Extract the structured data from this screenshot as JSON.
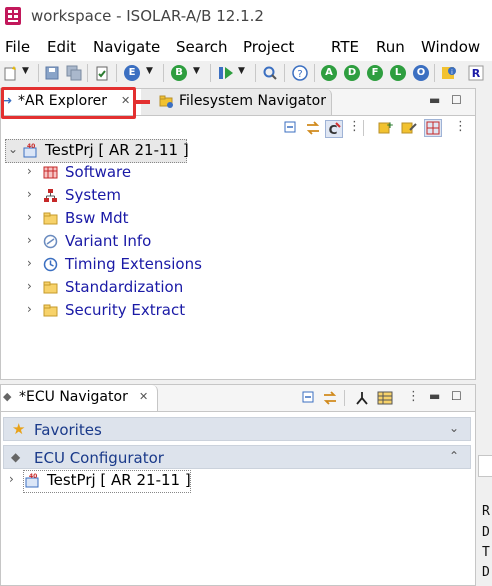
{
  "window": {
    "title": "workspace - ISOLAR-A/B 12.1.2"
  },
  "menu": [
    "File",
    "Edit",
    "Navigate",
    "Search",
    "Project",
    "RTE",
    "Run",
    "Window"
  ],
  "toolbar": {
    "circle_buttons": [
      {
        "letter": "E",
        "color": "#3b6fc1"
      },
      {
        "letter": "B",
        "color": "#2e9e3f"
      },
      {
        "letter": "A",
        "color": "#2e9e3f"
      },
      {
        "letter": "D",
        "color": "#2e9e3f"
      },
      {
        "letter": "F",
        "color": "#2e9e3f"
      },
      {
        "letter": "L",
        "color": "#2e9e3f"
      },
      {
        "letter": "O",
        "color": "#3b6fc1"
      }
    ]
  },
  "top_panel": {
    "tabs": [
      {
        "label": "*AR Explorer",
        "active": true
      },
      {
        "label": "Filesystem Navigator",
        "active": false
      }
    ],
    "tree": {
      "project": "TestPrj [ AR 21-11 ]",
      "children": [
        {
          "label": "Software",
          "icon": "software-icon"
        },
        {
          "label": "System",
          "icon": "system-icon"
        },
        {
          "label": "Bsw Mdt",
          "icon": "folder-icon"
        },
        {
          "label": "Variant Info",
          "icon": "variant-icon"
        },
        {
          "label": "Timing Extensions",
          "icon": "clock-icon"
        },
        {
          "label": "Standardization",
          "icon": "folder-icon"
        },
        {
          "label": "Security Extract",
          "icon": "folder-icon"
        }
      ]
    }
  },
  "bottom_panel": {
    "tab": {
      "label": "*ECU Navigator"
    },
    "sections": [
      {
        "label": "Favorites"
      },
      {
        "label": "ECU Configurator"
      }
    ],
    "project": "TestPrj [ AR 21-11 ]"
  },
  "right_strip": {
    "letters": [
      "R",
      "D",
      "T",
      "D"
    ]
  },
  "colors": {
    "highlight": "#e33030",
    "tree_link": "#1a1aa6",
    "section_bg": "#dde3ec"
  }
}
